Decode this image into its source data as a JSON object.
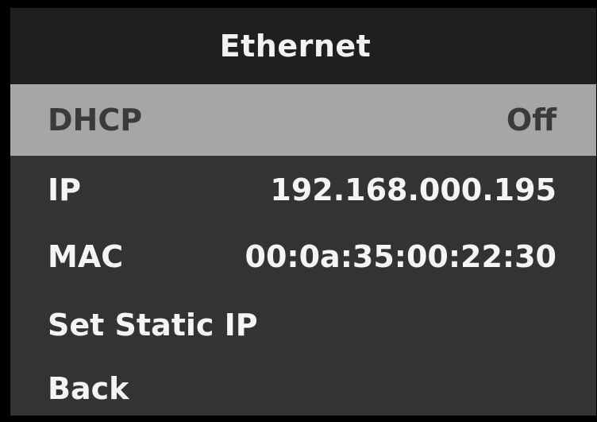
{
  "header": {
    "title": "Ethernet"
  },
  "menu": {
    "items": [
      {
        "label": "DHCP",
        "value": "Off",
        "selected": true
      },
      {
        "label": "IP",
        "value": "192.168.000.195"
      },
      {
        "label": "MAC",
        "value": "00:0a:35:00:22:30"
      },
      {
        "label": "Set Static IP"
      },
      {
        "label": "Back"
      }
    ]
  },
  "colors": {
    "background": "#333333",
    "header_background": "#1f1f1f",
    "selected_background": "#a6a6a6",
    "selected_text": "#3a3a3a",
    "text": "#f5f5f5"
  }
}
